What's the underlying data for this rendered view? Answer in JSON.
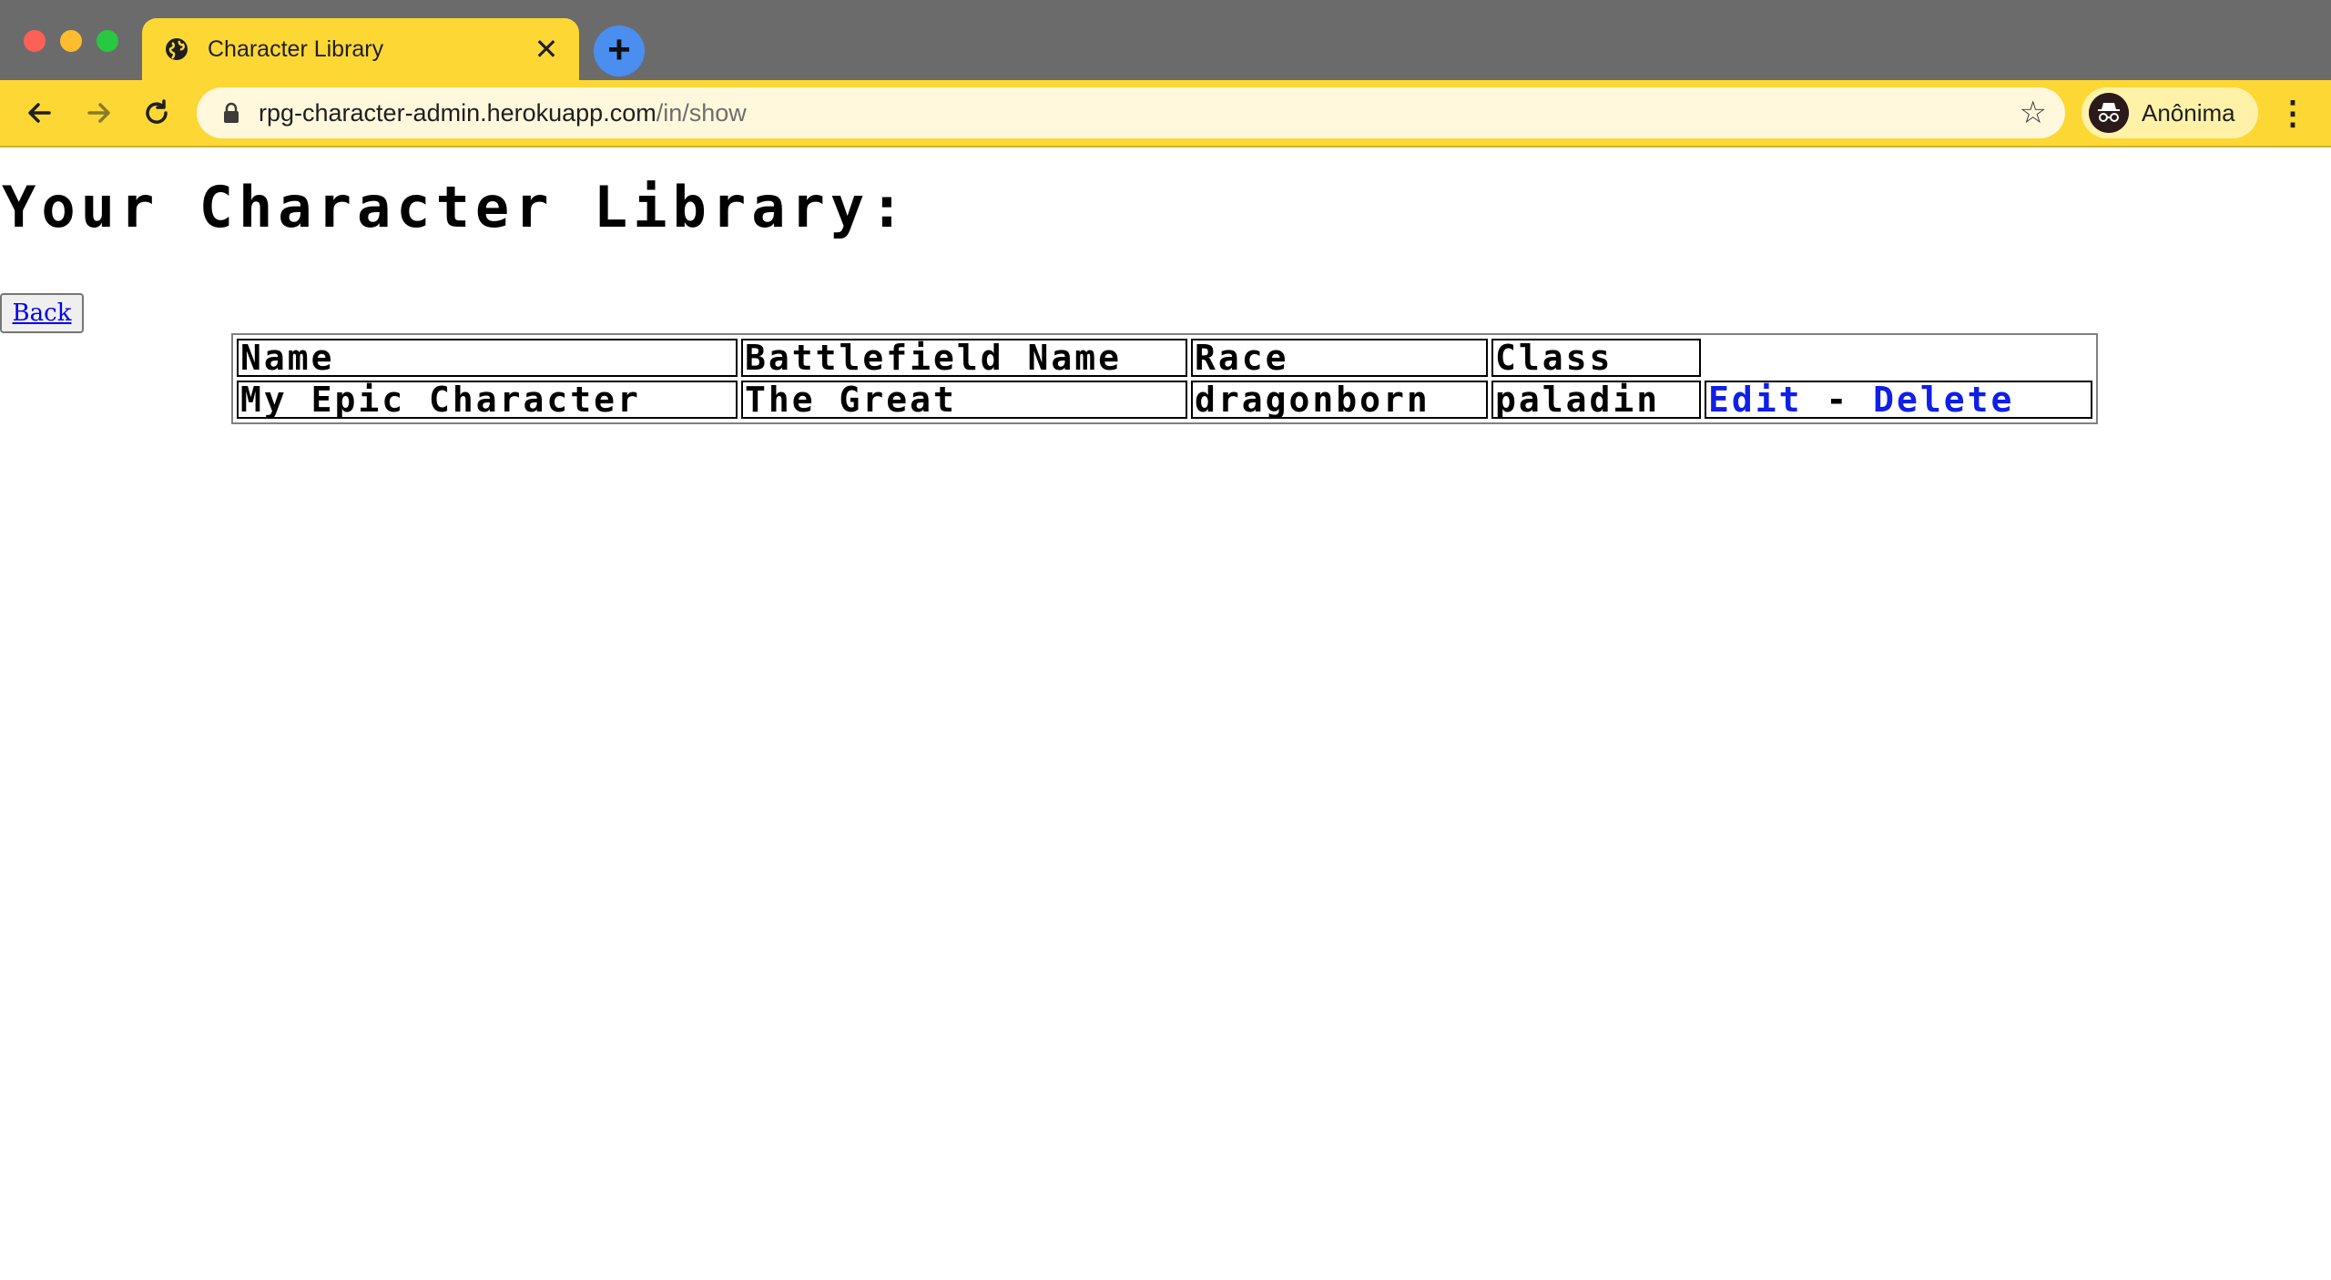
{
  "browser": {
    "tab_title": "Character Library",
    "new_tab_symbol": "+",
    "close_symbol": "✕",
    "url_host": "rpg-character-admin.herokuapp.com",
    "url_path": "/in/show",
    "profile_name": "Anônima",
    "icons": {
      "back": "arrow-left-icon",
      "forward": "arrow-right-icon",
      "reload": "reload-icon",
      "lock": "lock-icon",
      "star": "star-icon",
      "menu": "kebab-menu-icon",
      "incognito": "incognito-icon",
      "favicon": "globe-icon"
    },
    "colors": {
      "tabstrip": "#6b6b6b",
      "toolbar": "#fdd835",
      "new_tab": "#4a8ef0"
    }
  },
  "page": {
    "title": "Your Character Library:",
    "back_label": "Back",
    "table": {
      "headers": [
        "Name",
        "Battlefield Name",
        "Race",
        "Class"
      ],
      "rows": [
        {
          "name": "My Epic Character",
          "battlefield_name": "The Great",
          "race": "dragonborn",
          "class": "paladin",
          "edit_label": "Edit",
          "separator": " - ",
          "delete_label": "Delete"
        }
      ]
    },
    "colors": {
      "link": "#0f1fe6",
      "text": "#000000"
    }
  }
}
